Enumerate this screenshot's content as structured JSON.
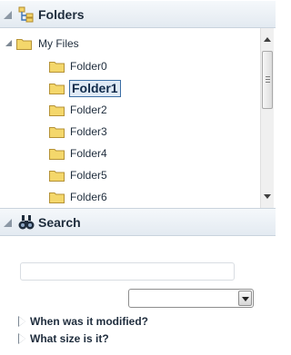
{
  "folders_panel": {
    "title": "Folders",
    "icon": "folder-tree-icon"
  },
  "tree": {
    "root": {
      "label": "My Files",
      "expanded": true
    },
    "items": [
      {
        "label": "Folder0",
        "selected": false
      },
      {
        "label": "Folder1",
        "selected": true
      },
      {
        "label": "Folder2",
        "selected": false
      },
      {
        "label": "Folder3",
        "selected": false
      },
      {
        "label": "Folder4",
        "selected": false
      },
      {
        "label": "Folder5",
        "selected": false
      },
      {
        "label": "Folder6",
        "selected": false
      }
    ]
  },
  "search_panel": {
    "title": "Search",
    "icon": "binoculars-icon",
    "input_value": "",
    "select_value": "",
    "expanders": [
      {
        "label": "When was it modified?"
      },
      {
        "label": "What size is it?"
      }
    ]
  },
  "colors": {
    "header_bg": "#e3eaf1",
    "selection_border": "#3b6ea5",
    "folder_yellow": "#f4d76b"
  }
}
